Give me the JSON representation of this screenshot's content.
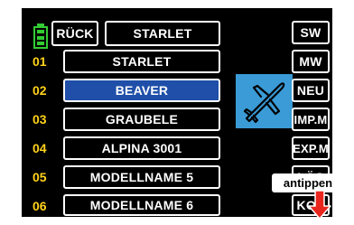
{
  "header": {
    "back_label": "RÜCK",
    "title": "STARLET"
  },
  "models": [
    {
      "num": "01",
      "name": "STARLET"
    },
    {
      "num": "02",
      "name": "BEAVER"
    },
    {
      "num": "03",
      "name": "GRAUBELE"
    },
    {
      "num": "04",
      "name": "ALPINA 3001"
    },
    {
      "num": "05",
      "name": "MODELLNAME 5"
    },
    {
      "num": "06",
      "name": "MODELLNAME 6"
    }
  ],
  "selected_index": 1,
  "right_buttons": [
    "SW",
    "MW",
    "NEU",
    "IMP.M",
    "EXP.M",
    "LÖS",
    "KOP"
  ],
  "hint": {
    "label": "antippen"
  },
  "icons": {
    "battery": "battery-icon",
    "model_type": "airplane-icon",
    "pointer": "arrow-down-icon"
  },
  "colors": {
    "background": "#000000",
    "number": "#ffd21a",
    "selected": "#1f4fa8",
    "model_icon_bg": "#3a9bd6",
    "battery": "#33cc33",
    "arrow": "#e8261d"
  }
}
